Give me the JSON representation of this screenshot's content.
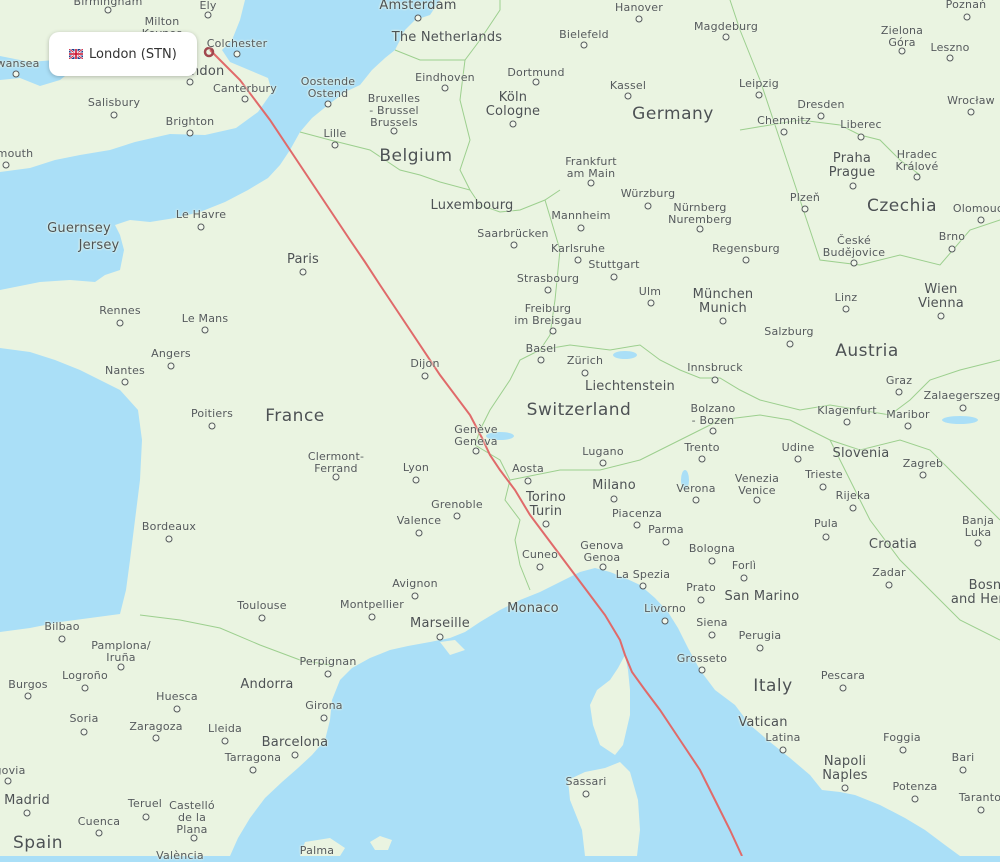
{
  "map": {
    "origin_popup": {
      "flag": "uk-flag",
      "label": "London (STN)"
    },
    "route": {
      "from": "London (STN)",
      "line_color": "#e06a6a"
    },
    "colors": {
      "sea": "#aadff7",
      "land": "#eaf4e1",
      "border": "#9ccf8e",
      "route": "#e06a6a"
    },
    "countries": [
      {
        "name": "The Netherlands"
      },
      {
        "name": "Germany"
      },
      {
        "name": "Belgium"
      },
      {
        "name": "Luxembourg"
      },
      {
        "name": "Czechia"
      },
      {
        "name": "France"
      },
      {
        "name": "Switzerland"
      },
      {
        "name": "Liechtenstein"
      },
      {
        "name": "Austria"
      },
      {
        "name": "Slovenia"
      },
      {
        "name": "Croatia"
      },
      {
        "name": "Bosnia and Herzegovina"
      },
      {
        "name": "San Marino"
      },
      {
        "name": "Italy"
      },
      {
        "name": "Vatican"
      },
      {
        "name": "Monaco"
      },
      {
        "name": "Andorra"
      },
      {
        "name": "Spain"
      },
      {
        "name": "Guernsey"
      },
      {
        "name": "Jersey"
      }
    ],
    "cities": [
      "Birmingham",
      "Ely",
      "Milton Keynes",
      "Colchester",
      "Swansea",
      "London",
      "Canterbury",
      "Salisbury",
      "Brighton",
      "Plymouth",
      "Amsterdam",
      "Hanover",
      "Bielefeld",
      "Magdeburg",
      "Poznań",
      "Zielona Góra",
      "Leszno",
      "Dortmund",
      "Eindhoven",
      "Oostende - Ostend",
      "Kassel",
      "Leipzig",
      "Köln - Cologne",
      "Bruxelles - Brussel - Brussels",
      "Dresden",
      "Wrocław",
      "Chemnitz",
      "Liberec",
      "Lille",
      "Praha - Prague",
      "Hradec Králové",
      "Frankfurt am Main",
      "Würzburg",
      "Plzeň",
      "Nürnberg - Nuremberg",
      "Le Havre",
      "Mannheim",
      "Saarbrücken",
      "Karlsruhe",
      "České Budějovice",
      "Brno",
      "Olomouc",
      "Regensburg",
      "Stuttgart",
      "Paris",
      "Strasbourg",
      "Ulm",
      "München - Munich",
      "Linz",
      "Wien - Vienna",
      "Rennes",
      "Le Mans",
      "Freiburg im Breisgau",
      "Salzburg",
      "Angers",
      "Basel",
      "Zürich",
      "Dijon",
      "Nantes",
      "Innsbruck",
      "Graz",
      "Zalaegerszeg",
      "Poitiers",
      "Klagenfurt",
      "Maribor",
      "Bolzano - Bozen",
      "Genève - Geneva",
      "Trento",
      "Udine",
      "Lugano",
      "Zagreb",
      "Clermont-Ferrand",
      "Lyon",
      "Aosta",
      "Trieste",
      "Milano",
      "Verona",
      "Venezia - Venice",
      "Rijeka",
      "Torino - Turin",
      "Grenoble",
      "Valence",
      "Piacenza",
      "Parma",
      "Pula",
      "Bordeaux",
      "Banja Luka",
      "Genova - Genoa",
      "Bologna",
      "Cuneo",
      "La Spezia",
      "Forlì",
      "Zadar",
      "Avignon",
      "Prato",
      "Toulouse",
      "Montpellier",
      "Marseille",
      "Livorno",
      "Bilbao",
      "Pamplona/ Iruña",
      "Siena",
      "Perugia",
      "Perpignan",
      "Grosseto",
      "Pescara",
      "Burgos",
      "Logroño",
      "Huesca",
      "Soria",
      "Zaragoza",
      "Lleida",
      "Girona",
      "Barcelona",
      "Latina",
      "Foggia",
      "Segovia",
      "Tarragona",
      "Sassari",
      "Bari",
      "Napoli - Naples",
      "Potenza",
      "Madrid",
      "Teruel",
      "Castelló de la Plana",
      "Taranto",
      "Cuenca",
      "Palma",
      "València"
    ]
  }
}
